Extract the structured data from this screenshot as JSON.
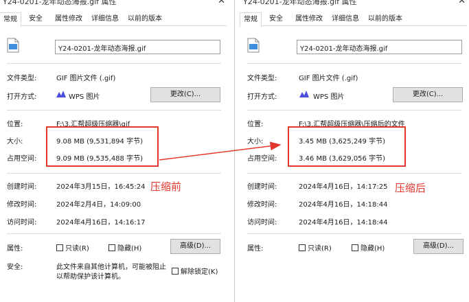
{
  "tabs": [
    "常规",
    "安全",
    "属性修改",
    "详细信息",
    "以前的版本"
  ],
  "labels": {
    "file_type": "文件类型:",
    "open_with": "打开方式:",
    "location": "位置:",
    "size": "大小:",
    "disk_size": "占用空间:",
    "created": "创建时间:",
    "modified": "修改时间:",
    "accessed": "访问时间:",
    "attributes": "属性:",
    "security": "安全:"
  },
  "buttons": {
    "change": "更改(C)...",
    "advanced": "高级(D)..."
  },
  "checkboxes": {
    "readonly": "只读(R)",
    "hidden": "隐藏(H)",
    "unblock": "解除锁定(K)"
  },
  "colors": {
    "highlight": "#e2372d",
    "wps_icon": "#4b4fdc",
    "gif_icon": "#3f8ede"
  },
  "left": {
    "title": "Y24-0201-龙年动态海报.gif 属性",
    "filename": "Y24-0201-龙年动态海报.gif",
    "file_type": "GIF 图片文件 (.gif)",
    "open_with": "WPS 图片",
    "location": "F:\\3.汇帮超级压缩器\\gif",
    "size": "9.08 MB (9,531,894 字节)",
    "disk_size": "9.09 MB (9,535,488 字节)",
    "created": "2024年3月15日，16:45:24",
    "modified": "2024年2月4日，14:09:00",
    "accessed": "2024年4月16日，14:16:17",
    "security_text_1": "此文件来自其他计算机，可能被阻止",
    "security_text_2": "以帮助保护该计算机。",
    "annotation": "压缩前"
  },
  "right": {
    "title": "Y24-0201-龙年动态海报.gif 属性",
    "filename": "Y24-0201-龙年动态海报.gif",
    "file_type": "GIF 图片文件 (.gif)",
    "open_with": "WPS 图片",
    "location": "F:\\3.汇帮超级压缩器\\压缩后的文件",
    "size": "3.45 MB (3,625,249 字节)",
    "disk_size": "3.46 MB (3,629,056 字节)",
    "created": "2024年4月16日，14:17:25",
    "modified": "2024年4月16日，14:18:44",
    "accessed": "2024年4月16日，14:18:44",
    "annotation": "压缩后"
  }
}
